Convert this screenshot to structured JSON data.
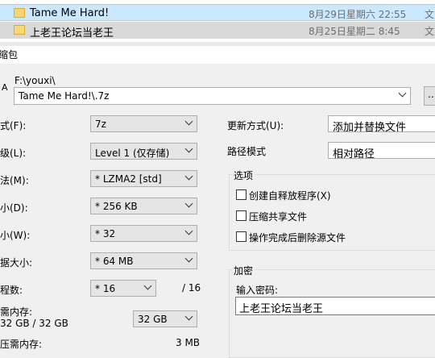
{
  "files": [
    {
      "name": "Tame Me Hard!",
      "date": "8月29日星期六 22:55",
      "type": "文"
    },
    {
      "name": "上老王论坛当老王",
      "date": "8月25日星期二 8:45",
      "type": "文"
    }
  ],
  "dialog": {
    "title": "缩包",
    "path_label": "F:\\youxi\\",
    "archive_name": "Tame Me Hard!\\.7z",
    "browse_label": "..."
  },
  "left": {
    "format": {
      "label": "式(F):",
      "value": "7z"
    },
    "level": {
      "label": "级(L):",
      "value": "Level 1 (仅存储)"
    },
    "method": {
      "label": "法(M):",
      "value": "* LZMA2 [std]"
    },
    "dict": {
      "label": "小(D):",
      "value": "* 256 KB"
    },
    "word": {
      "label": "小(W):",
      "value": "* 32"
    },
    "solid": {
      "label": "据大小:",
      "value": "* 64 MB"
    },
    "threads": {
      "label": "程数:",
      "value": "* 16",
      "max": "/ 16"
    },
    "memory": {
      "label": "需内存:",
      "detail": "32 GB / 32 GB",
      "value": "32 GB"
    },
    "decomp": {
      "label": "压需内存:",
      "value": "3 MB"
    }
  },
  "right": {
    "update_mode": {
      "label": "更新方式(U):",
      "value": "添加并替换文件"
    },
    "path_mode": {
      "label": "路径模式",
      "value": "相对路径"
    },
    "options": {
      "title": "选项",
      "items": [
        "创建自释放程序(X)",
        "压缩共享文件",
        "操作完成后删除源文件"
      ]
    },
    "encryption": {
      "title": "加密",
      "password_label": "输入密码:",
      "password_value": "上老王论坛当老王"
    }
  }
}
